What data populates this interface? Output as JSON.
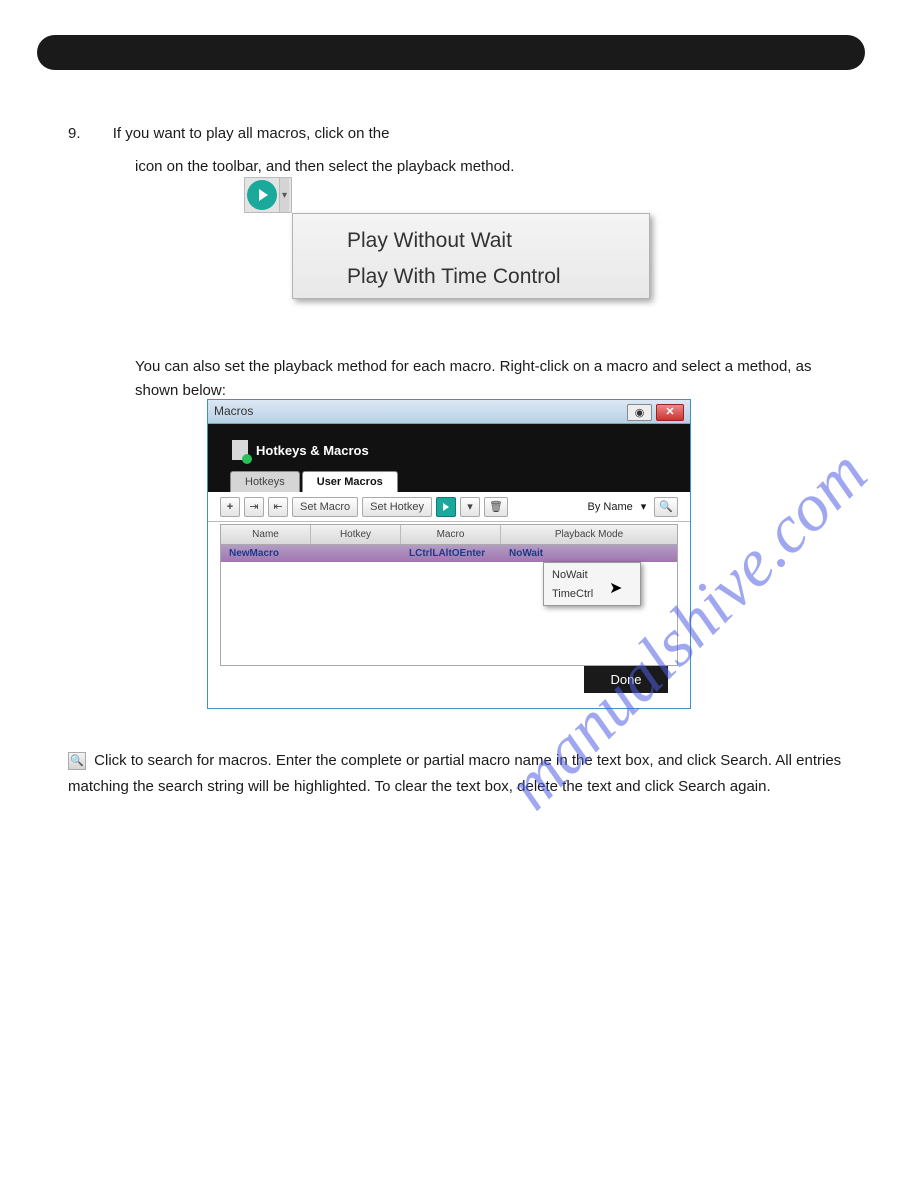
{
  "section_number": "9.",
  "text1": "If you want to play all macros, click on the",
  "text2": "icon on the toolbar, and then select the playback method.",
  "play_menu": {
    "item1": "Play Without Wait",
    "item2": "Play With Time Control"
  },
  "text3": "You can also set the playback method for each macro. Right-click on a macro and select a method, as shown below:",
  "dialog": {
    "title": "Macros",
    "header": "Hotkeys & Macros",
    "tabs": {
      "hotkeys": "Hotkeys",
      "user_macros": "User Macros"
    },
    "toolbar": {
      "set_macro": "Set Macro",
      "set_hotkey": "Set Hotkey",
      "sort": "By Name"
    },
    "columns": {
      "name": "Name",
      "hotkey": "Hotkey",
      "macro": "Macro",
      "playback": "Playback Mode"
    },
    "row": {
      "name": "NewMacro",
      "hotkey": "",
      "macro": "LCtrlLAltOEnter",
      "playback": "NoWait"
    },
    "context": {
      "nowait": "NoWait",
      "timectrl": "TimeCtrl"
    },
    "done": "Done"
  },
  "search_text": " Click to search for macros. Enter the complete or partial macro name in the text box, and click  Search. All entries matching the search string will be highlighted. To clear the text box, delete the text and click  Search again.",
  "watermark": "manualshive.com"
}
